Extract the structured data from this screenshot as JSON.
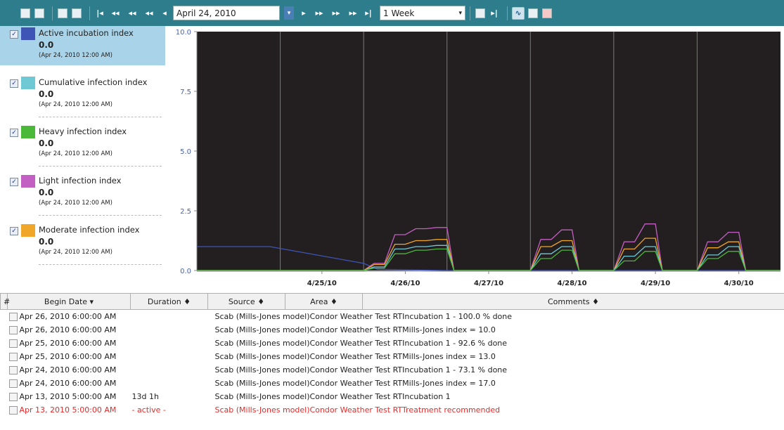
{
  "toolbar": {
    "date_value": "April 24, 2010",
    "range_value": "1 Week",
    "icons": [
      "save-icon",
      "save-as-icon",
      "print-icon",
      "export-icon",
      "first-icon",
      "back-large-icon",
      "back-medium-icon",
      "back-small-icon",
      "back-icon",
      "calendar-drop-icon",
      "forward-icon",
      "forward-small-icon",
      "forward-medium-icon",
      "forward-large-icon",
      "last-icon",
      "range-drop-icon",
      "chart-type-icon",
      "pan-icon",
      "line-view-icon",
      "table-view-icon",
      "thermometer-icon"
    ]
  },
  "legend": {
    "items": [
      {
        "name": "Active incubation index",
        "value": "0.0",
        "date": "(Apr 24, 2010 12:00 AM)",
        "color": "#3f55b5",
        "checked": "✓"
      },
      {
        "name": "Cumulative infection index",
        "value": "0.0",
        "date": "(Apr 24, 2010 12:00 AM)",
        "color": "#6fc9d4",
        "checked": "✓"
      },
      {
        "name": "Heavy infection index",
        "value": "0.0",
        "date": "(Apr 24, 2010 12:00 AM)",
        "color": "#4cb83a",
        "checked": "✓"
      },
      {
        "name": "Light infection index",
        "value": "0.0",
        "date": "(Apr 24, 2010 12:00 AM)",
        "color": "#c35fc2",
        "checked": "✓"
      },
      {
        "name": "Moderate infection index",
        "value": "0.0",
        "date": "(Apr 24, 2010 12:00 AM)",
        "color": "#f0a629",
        "checked": "✓"
      }
    ]
  },
  "chart_data": {
    "type": "line",
    "ylim": [
      0,
      10
    ],
    "yticks": [
      "10.0",
      "7.5",
      "5.0",
      "2.5",
      "0.0"
    ],
    "xticks": [
      "4/25/10",
      "4/26/10",
      "4/27/10",
      "4/28/10",
      "4/29/10",
      "4/30/10"
    ],
    "xlim": [
      "4/24/10 00:00",
      "5/1/10 00:00"
    ],
    "grid": true,
    "background": "#231f20",
    "series": [
      {
        "name": "Active incubation index",
        "color": "#3f55b5",
        "x": [
          "4/24/10 00:00",
          "4/24/10 21:00",
          "4/26/10 00:00",
          "4/26/10 04:00",
          "4/27/10 00:00",
          "4/27/10 00:00",
          "4/28/10 00:00",
          "4/29/10 00:00",
          "4/30/10 00:00",
          "5/1/10 00:00"
        ],
        "y": [
          1.0,
          1.0,
          0.3,
          0.05,
          0.0,
          0.0,
          0.0,
          0.0,
          0.0,
          0.0
        ]
      },
      {
        "name": "Light infection index",
        "color": "#c35fc2",
        "x": [
          "4/24/10 00:00",
          "4/26/10 00:00",
          "4/26/10 03:00",
          "4/26/10 06:00",
          "4/26/10 09:00",
          "4/26/10 12:00",
          "4/26/10 15:00",
          "4/26/10 18:00",
          "4/26/10 21:00",
          "4/27/10 00:00",
          "4/27/10 02:00",
          "4/27/10 22:00",
          "4/28/10 00:00",
          "4/28/10 03:00",
          "4/28/10 06:00",
          "4/28/10 09:00",
          "4/28/10 12:00",
          "4/28/10 14:00",
          "4/28/10 22:00",
          "4/29/10 00:00",
          "4/29/10 03:00",
          "4/29/10 06:00",
          "4/29/10 09:00",
          "4/29/10 12:00",
          "4/29/10 14:00",
          "4/29/10 22:00",
          "4/30/10 00:00",
          "4/30/10 03:00",
          "4/30/10 06:00",
          "4/30/10 09:00",
          "4/30/10 12:00",
          "4/30/10 14:00",
          "5/1/10 00:00"
        ],
        "y": [
          0,
          0,
          0.3,
          0.3,
          1.5,
          1.5,
          1.75,
          1.75,
          1.8,
          1.8,
          0,
          0,
          0,
          1.3,
          1.3,
          1.7,
          1.7,
          0,
          0,
          0,
          1.2,
          1.2,
          1.95,
          1.95,
          0,
          0,
          0,
          1.2,
          1.2,
          1.6,
          1.6,
          0,
          0
        ]
      },
      {
        "name": "Moderate infection index",
        "color": "#f0a629",
        "x": [
          "4/24/10 00:00",
          "4/26/10 00:00",
          "4/26/10 03:00",
          "4/26/10 06:00",
          "4/26/10 09:00",
          "4/26/10 12:00",
          "4/26/10 15:00",
          "4/26/10 18:00",
          "4/26/10 21:00",
          "4/27/10 00:00",
          "4/27/10 02:00",
          "4/27/10 22:00",
          "4/28/10 00:00",
          "4/28/10 03:00",
          "4/28/10 06:00",
          "4/28/10 09:00",
          "4/28/10 12:00",
          "4/28/10 14:00",
          "4/28/10 22:00",
          "4/29/10 00:00",
          "4/29/10 03:00",
          "4/29/10 06:00",
          "4/29/10 09:00",
          "4/29/10 12:00",
          "4/29/10 14:00",
          "4/29/10 22:00",
          "4/30/10 00:00",
          "4/30/10 03:00",
          "4/30/10 06:00",
          "4/30/10 09:00",
          "4/30/10 12:00",
          "4/30/10 14:00",
          "5/1/10 00:00"
        ],
        "y": [
          0,
          0,
          0.25,
          0.25,
          1.1,
          1.1,
          1.25,
          1.25,
          1.3,
          1.3,
          0,
          0,
          0,
          1.0,
          1.0,
          1.25,
          1.25,
          0,
          0,
          0,
          0.9,
          0.9,
          1.35,
          1.35,
          0,
          0,
          0,
          0.95,
          0.95,
          1.2,
          1.2,
          0,
          0
        ]
      },
      {
        "name": "Cumulative infection index",
        "color": "#6fc9d4",
        "x": [
          "4/24/10 00:00",
          "4/26/10 00:00",
          "4/26/10 03:00",
          "4/26/10 06:00",
          "4/26/10 09:00",
          "4/26/10 12:00",
          "4/26/10 15:00",
          "4/26/10 18:00",
          "4/26/10 21:00",
          "4/27/10 00:00",
          "4/27/10 02:00",
          "4/27/10 22:00",
          "4/28/10 00:00",
          "4/28/10 03:00",
          "4/28/10 06:00",
          "4/28/10 09:00",
          "4/28/10 12:00",
          "4/28/10 14:00",
          "4/28/10 22:00",
          "4/29/10 00:00",
          "4/29/10 03:00",
          "4/29/10 06:00",
          "4/29/10 09:00",
          "4/29/10 12:00",
          "4/29/10 14:00",
          "4/29/10 22:00",
          "4/30/10 00:00",
          "4/30/10 03:00",
          "4/30/10 06:00",
          "4/30/10 09:00",
          "4/30/10 12:00",
          "4/30/10 14:00",
          "5/1/10 00:00"
        ],
        "y": [
          0,
          0,
          0.15,
          0.15,
          0.9,
          0.9,
          1.0,
          1.0,
          1.05,
          1.05,
          0,
          0,
          0,
          0.7,
          0.7,
          1.0,
          1.0,
          0,
          0,
          0,
          0.6,
          0.6,
          1.0,
          1.0,
          0,
          0,
          0,
          0.65,
          0.65,
          1.0,
          1.0,
          0,
          0
        ]
      },
      {
        "name": "Heavy infection index",
        "color": "#4cb83a",
        "x": [
          "4/24/10 00:00",
          "4/26/10 00:00",
          "4/26/10 03:00",
          "4/26/10 06:00",
          "4/26/10 09:00",
          "4/26/10 12:00",
          "4/26/10 15:00",
          "4/26/10 18:00",
          "4/26/10 21:00",
          "4/27/10 00:00",
          "4/27/10 02:00",
          "4/27/10 22:00",
          "4/28/10 00:00",
          "4/28/10 03:00",
          "4/28/10 06:00",
          "4/28/10 09:00",
          "4/28/10 12:00",
          "4/28/10 14:00",
          "4/28/10 22:00",
          "4/29/10 00:00",
          "4/29/10 03:00",
          "4/29/10 06:00",
          "4/29/10 09:00",
          "4/29/10 12:00",
          "4/29/10 14:00",
          "4/29/10 22:00",
          "4/30/10 00:00",
          "4/30/10 03:00",
          "4/30/10 06:00",
          "4/30/10 09:00",
          "4/30/10 12:00",
          "4/30/10 14:00",
          "5/1/10 00:00"
        ],
        "y": [
          0,
          0,
          0.1,
          0.1,
          0.7,
          0.7,
          0.85,
          0.85,
          0.9,
          0.9,
          0,
          0,
          0,
          0.5,
          0.5,
          0.85,
          0.85,
          0,
          0,
          0,
          0.4,
          0.4,
          0.8,
          0.8,
          0,
          0,
          0,
          0.5,
          0.5,
          0.8,
          0.8,
          0,
          0
        ]
      }
    ]
  },
  "grid": {
    "headers": [
      "#",
      "Begin Date ▾",
      "Duration ♦",
      "Source ♦",
      "Area ♦",
      "Comments ♦"
    ],
    "rows": [
      {
        "date": "Apr 26, 2010 6:00:00 AM",
        "duration": "",
        "source": "Scab (Mills-Jones model)",
        "area": "Condor Weather Test RT",
        "comment": "Incubation 1 - 100.0 % done"
      },
      {
        "date": "Apr 26, 2010 6:00:00 AM",
        "duration": "",
        "source": "Scab (Mills-Jones model)",
        "area": "Condor Weather Test RT",
        "comment": "Mills-Jones index = 10.0"
      },
      {
        "date": "Apr 25, 2010 6:00:00 AM",
        "duration": "",
        "source": "Scab (Mills-Jones model)",
        "area": "Condor Weather Test RT",
        "comment": "Incubation 1 - 92.6 % done"
      },
      {
        "date": "Apr 25, 2010 6:00:00 AM",
        "duration": "",
        "source": "Scab (Mills-Jones model)",
        "area": "Condor Weather Test RT",
        "comment": "Mills-Jones index = 13.0"
      },
      {
        "date": "Apr 24, 2010 6:00:00 AM",
        "duration": "",
        "source": "Scab (Mills-Jones model)",
        "area": "Condor Weather Test RT",
        "comment": "Incubation 1 - 73.1 % done"
      },
      {
        "date": "Apr 24, 2010 6:00:00 AM",
        "duration": "",
        "source": "Scab (Mills-Jones model)",
        "area": "Condor Weather Test RT",
        "comment": "Mills-Jones index = 17.0"
      },
      {
        "date": "Apr 13, 2010 5:00:00 AM",
        "duration": "13d 1h",
        "source": "Scab (Mills-Jones model)",
        "area": "Condor Weather Test RT",
        "comment": "Incubation 1"
      },
      {
        "date": "Apr 13, 2010 5:00:00 AM",
        "duration": "- active -",
        "source": "Scab (Mills-Jones model)",
        "area": "Condor Weather Test RT",
        "comment": "Treatment recommended",
        "highlight": "red"
      }
    ]
  },
  "colors": {
    "toolbar": "#2e7d8c",
    "selected_legend": "#a8d3e8",
    "alert": "#e52b2b"
  }
}
